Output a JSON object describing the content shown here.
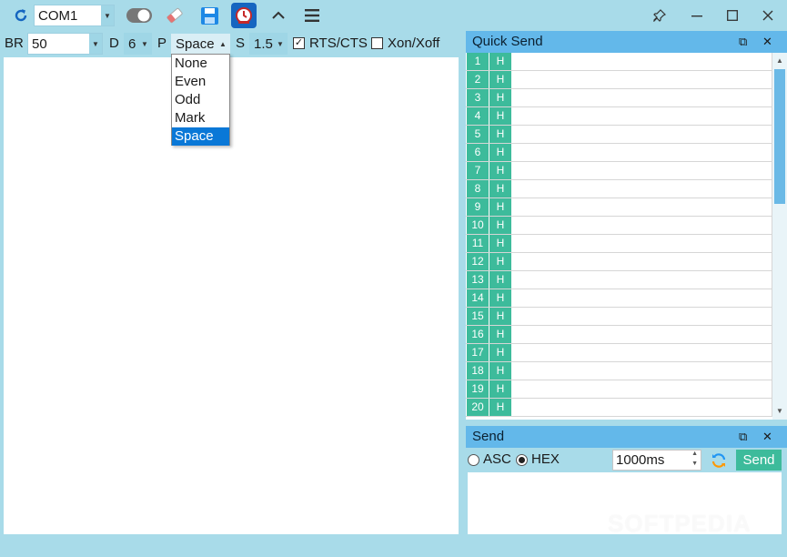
{
  "toolbar": {
    "port_value": "COM1",
    "icons": [
      "refresh-icon",
      "toggle-switch-icon",
      "eraser-icon",
      "save-icon",
      "timer-icon",
      "chevron-up-icon",
      "menu-icon"
    ]
  },
  "window": {
    "buttons": [
      "pin-icon",
      "minimize-icon",
      "maximize-icon",
      "close-icon"
    ]
  },
  "settings": {
    "br_label": "BR",
    "br_value": "50",
    "d_label": "D",
    "d_value": "6",
    "p_label": "P",
    "p_value": "Space",
    "s_label": "S",
    "s_value": "1.5",
    "rts_label": "RTS/CTS",
    "rts_checked": true,
    "xon_label": "Xon/Xoff",
    "xon_checked": false
  },
  "parity_options": [
    "None",
    "Even",
    "Odd",
    "Mark",
    "Space"
  ],
  "parity_selected": "Space",
  "quick_send": {
    "title": "Quick Send",
    "rows": [
      {
        "num": "1",
        "h": "H"
      },
      {
        "num": "2",
        "h": "H"
      },
      {
        "num": "3",
        "h": "H"
      },
      {
        "num": "4",
        "h": "H"
      },
      {
        "num": "5",
        "h": "H"
      },
      {
        "num": "6",
        "h": "H"
      },
      {
        "num": "7",
        "h": "H"
      },
      {
        "num": "8",
        "h": "H"
      },
      {
        "num": "9",
        "h": "H"
      },
      {
        "num": "10",
        "h": "H"
      },
      {
        "num": "11",
        "h": "H"
      },
      {
        "num": "12",
        "h": "H"
      },
      {
        "num": "13",
        "h": "H"
      },
      {
        "num": "14",
        "h": "H"
      },
      {
        "num": "15",
        "h": "H"
      },
      {
        "num": "16",
        "h": "H"
      },
      {
        "num": "17",
        "h": "H"
      },
      {
        "num": "18",
        "h": "H"
      },
      {
        "num": "19",
        "h": "H"
      },
      {
        "num": "20",
        "h": "H"
      }
    ]
  },
  "send": {
    "title": "Send",
    "asc_label": "ASC",
    "hex_label": "HEX",
    "mode_selected": "HEX",
    "interval_value": "1000ms",
    "send_label": "Send"
  },
  "watermark": "SOFTPEDIA",
  "colors": {
    "background": "#a8dbe9",
    "panel_header": "#63b8ea",
    "accent_teal": "#3dbb9b",
    "selection_blue": "#0a78d7"
  }
}
